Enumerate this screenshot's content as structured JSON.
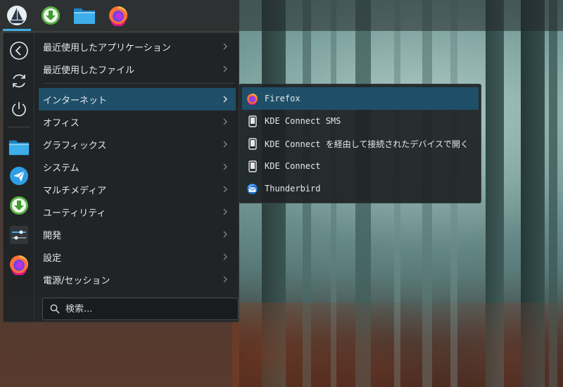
{
  "topbar": {
    "items": [
      {
        "name": "application-launcher",
        "icon": "kde-launcher-boat-icon",
        "active": true
      },
      {
        "name": "download-manager",
        "icon": "download-arrow-icon"
      },
      {
        "name": "file-manager",
        "icon": "folder-icon"
      },
      {
        "name": "firefox",
        "icon": "firefox-icon"
      }
    ]
  },
  "sidebar": {
    "items": [
      {
        "name": "back",
        "icon": "back-arrow-icon"
      },
      {
        "name": "refresh",
        "icon": "refresh-icon"
      },
      {
        "name": "power",
        "icon": "power-icon"
      },
      {
        "name": "files",
        "icon": "folder-icon"
      },
      {
        "name": "plane-app",
        "icon": "paper-plane-icon"
      },
      {
        "name": "downloader",
        "icon": "download-arrow-icon"
      },
      {
        "name": "settings",
        "icon": "settings-sliders-icon"
      },
      {
        "name": "firefox",
        "icon": "firefox-icon"
      }
    ]
  },
  "menu": {
    "categories": [
      {
        "label": "最近使用したアプリケーション"
      },
      {
        "label": "最近使用したファイル"
      },
      {
        "label": "インターネット",
        "selected": true
      },
      {
        "label": "オフィス"
      },
      {
        "label": "グラフィックス"
      },
      {
        "label": "システム"
      },
      {
        "label": "マルチメディア"
      },
      {
        "label": "ユーティリティ"
      },
      {
        "label": "開発"
      },
      {
        "label": "設定"
      },
      {
        "label": "電源/セッション"
      }
    ],
    "search_placeholder": "検索..."
  },
  "submenu": {
    "items": [
      {
        "label": "Firefox",
        "icon": "firefox-icon",
        "selected": true
      },
      {
        "label": "KDE Connect SMS",
        "icon": "phone-icon"
      },
      {
        "label": "KDE Connect を経由して接続されたデバイスで開く",
        "icon": "phone-icon"
      },
      {
        "label": "KDE Connect",
        "icon": "phone-icon"
      },
      {
        "label": "Thunderbird",
        "icon": "thunderbird-icon"
      }
    ]
  },
  "colors": {
    "accent": "#3daee9",
    "selection": "#1f4f68",
    "menu_bg": "#1e2225",
    "text": "#e6e8ea"
  }
}
